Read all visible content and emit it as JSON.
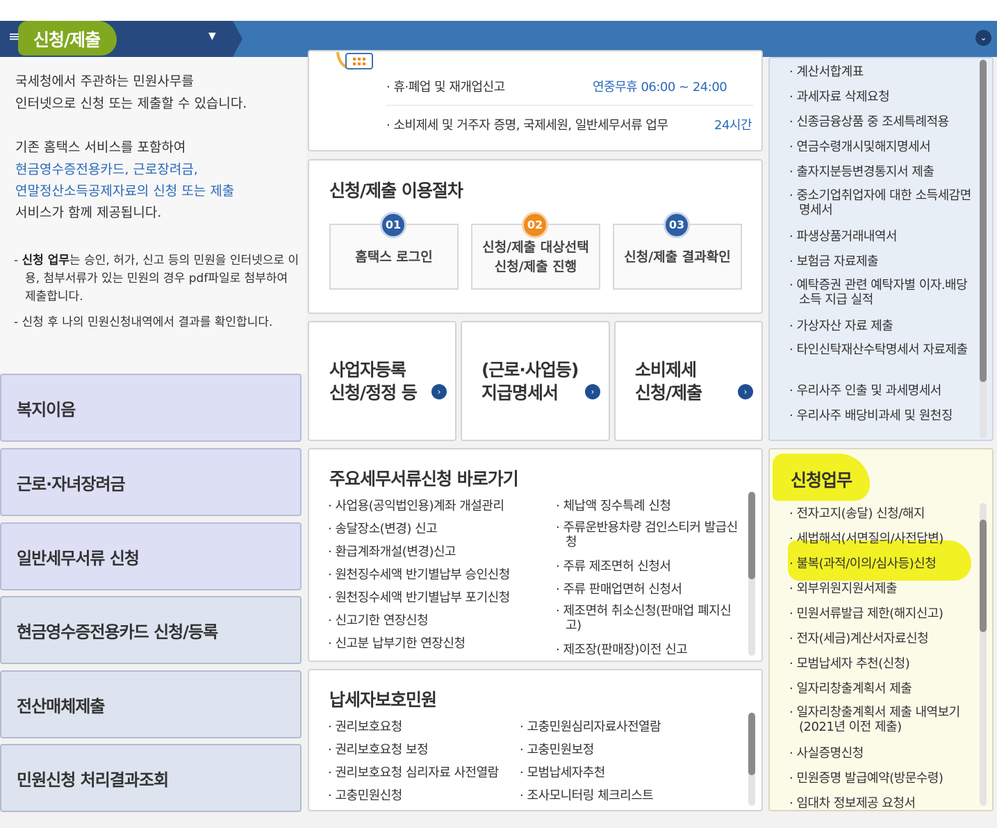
{
  "header": {
    "title": "신청/제출"
  },
  "intro": {
    "line1": "국세청에서 주관하는 민원사무를",
    "line2": "인터넷으로 신청 또는 제출할 수 있습니다.",
    "line3": "기존 홈택스 서비스를 포함하여",
    "link1": "현금영수증전용카드, 근로장려금,",
    "link2": "연말정산소득공제자료의 신청 또는 제출",
    "line4": "서비스가 함께 제공됩니다.",
    "note1_bold": "신청 업무",
    "note1_rest": "는 승인, 허가, 신고 등의 민원을 인터넷으로 이용, 첨부서류가 있는 민원의 경우 pdf파일로 첨부하여 제출합니다.",
    "note2": "- 신청 후 나의 민원신청내역에서 결과를 확인합니다."
  },
  "left_menu": [
    "복지이음",
    "근로·자녀장려금",
    "일반세무서류 신청",
    "현금영수증전용카드 신청/등록",
    "전산매체제출",
    "민원신청 처리결과조회"
  ],
  "hours": [
    {
      "label": "· 휴·폐업 및 재개업신고",
      "time": "연중무휴 06:00 ~ 24:00"
    },
    {
      "label": "· 소비제세 및 거주자 증명, 국제세원, 일반세무서류 업무",
      "time": "24시간"
    }
  ],
  "procedure": {
    "title": "신청/제출 이용절차",
    "steps": [
      {
        "num": "01",
        "line1": "홈택스 로그인",
        "line2": ""
      },
      {
        "num": "02",
        "line1": "신청/제출 대상선택",
        "line2": "신청/제출 진행"
      },
      {
        "num": "03",
        "line1": "신청/제출 결과확인",
        "line2": ""
      }
    ]
  },
  "cards": [
    {
      "line1": "사업자등록",
      "line2": "신청/정정 등"
    },
    {
      "line1": "(근로·사업등)",
      "line2": "지급명세서"
    },
    {
      "line1": "소비제세",
      "line2": "신청/제출"
    }
  ],
  "shortcuts": {
    "title": "주요세무서류신청 바로가기",
    "col1": [
      "· 사업용(공익법인용)계좌 개설관리",
      "· 송달장소(변경) 신고",
      "· 환급계좌개설(변경)신고",
      "· 원천징수세액 반기별납부 승인신청",
      "· 원천징수세액 반기별납부 포기신청",
      "· 신고기한 연장신청",
      "· 신고분 납부기한 연장신청"
    ],
    "col2": [
      "· 체납액 징수특례 신청",
      "· 주류운반용차량 검인스티커 발급신청",
      "· 주류 제조면허 신청서",
      "· 주류 판매업면허 신청서",
      "· 제조면허 취소신청(판매업 폐지신고)",
      "· 제조장(판매장)이전 신고"
    ]
  },
  "protection": {
    "title": "납세자보호민원",
    "col1": [
      "· 권리보호요청",
      "· 권리보호요청 보정",
      "· 권리보호요청 심리자료 사전열람",
      "· 고충민원신청"
    ],
    "col2": [
      "· 고충민원심리자료사전열람",
      "· 고충민원보정",
      "· 모범납세자추천",
      "· 조사모니터링 체크리스트"
    ]
  },
  "right_top_items": [
    "· 계산서합계표",
    "· 과세자료 삭제요청",
    "· 신종금융상품 중 조세특례적용",
    "· 연금수령개시및해지명세서",
    "· 출자지분등변경통지서 제출",
    "· 중소기업취업자에 대한 소득세감면명세서",
    "· 파생상품거래내역서",
    "· 보험금 자료제출",
    "· 예탁증권 관련 예탁자별 이자.배당소득 지급 실적",
    "· 가상자산 자료 제출",
    "· 타인신탁재산수탁명세서 자료제출",
    "· 우리사주 인출 및 과세명세서",
    "· 우리사주 배당비과세 및 원천징"
  ],
  "application": {
    "title": "신청업무",
    "items": [
      "· 전자고지(송달) 신청/해지",
      "· 세법해석(서면질의/사전답변)",
      "· 불복(과적/이의/심사등)신청",
      "· 외부위원지원서제출",
      "· 민원서류발급 제한(해지신고)",
      "· 전자(세금)계산서자료신청",
      "· 모범납세자 추천(신청)",
      "· 일자리창출계획서 제출",
      "· 일자리창출계획서 제출 내역보기(2021년 이전 제출)",
      "· 사실증명신청",
      "· 민원증명 발급예약(방문수령)",
      "· 임대차 정보제공 요청서"
    ]
  }
}
